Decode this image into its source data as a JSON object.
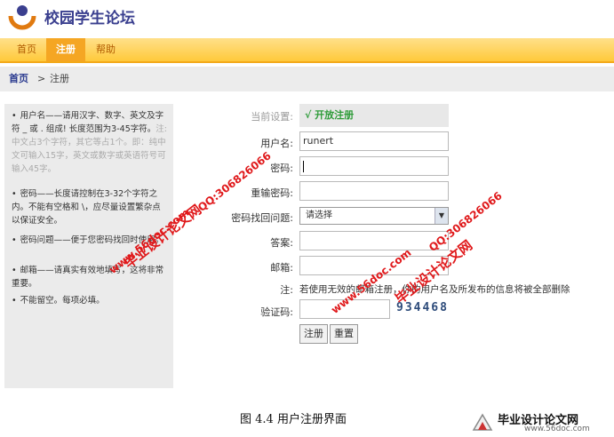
{
  "header": {
    "site_title": "校园学生论坛"
  },
  "nav": {
    "tabs": [
      {
        "label": "首页"
      },
      {
        "label": "注册"
      },
      {
        "label": "帮助"
      }
    ],
    "active": "注册"
  },
  "breadcrumb": {
    "home": "首页",
    "separator": ">",
    "current": "注册"
  },
  "notes": [
    {
      "main": "用户名——请用汉字、数字、英文及字符 _ 或 . 组成! 长度范围为3-45字符。",
      "gray": "注: 中文占3个字符，其它等占1个。即：纯中文可输入15字，英文或数字或英语符号可输入45字。"
    },
    {
      "main": "密码——长度请控制在3-32个字符之内。不能有空格和 \\，应尽量设置繁杂点以保证安全。",
      "gray": ""
    },
    {
      "main": "密码问题——便于您密码找回时使用。",
      "gray": ""
    },
    {
      "main": "邮箱——请真实有效地填写，这将非常重要。",
      "gray": ""
    },
    {
      "main": "不能留空。每项必填。",
      "gray": ""
    }
  ],
  "form": {
    "status_label": "当前设置:",
    "status_value": "√ 开放注册",
    "username_label": "用户名:",
    "username_value": "runert",
    "password_label": "密码:",
    "confirm_label": "重输密码:",
    "question_label": "密码找回问题:",
    "question_value": "请选择",
    "answer_label": "答案:",
    "email_label": "邮箱:",
    "note_label": "注:",
    "note_text": "若使用无效的邮箱注册，你的用户名及所发布的信息将被全部删除",
    "captcha_label": "验证码:",
    "captcha_value": "934468",
    "submit_label": "注册",
    "reset_label": "重置"
  },
  "caption": "图 4.4 用户注册界面",
  "watermarks": {
    "brand": "毕业设计论文网",
    "url": "www.56doc.com",
    "qq": "QQ:306826066"
  },
  "corner_logo": {
    "title": "毕业设计论文网",
    "url": "www.56doc.com"
  },
  "colors": {
    "nav_bg": "#ffc93a",
    "nav_active": "#f5a623",
    "watermark": "#e0191b",
    "status_green": "#2f9c3a"
  }
}
